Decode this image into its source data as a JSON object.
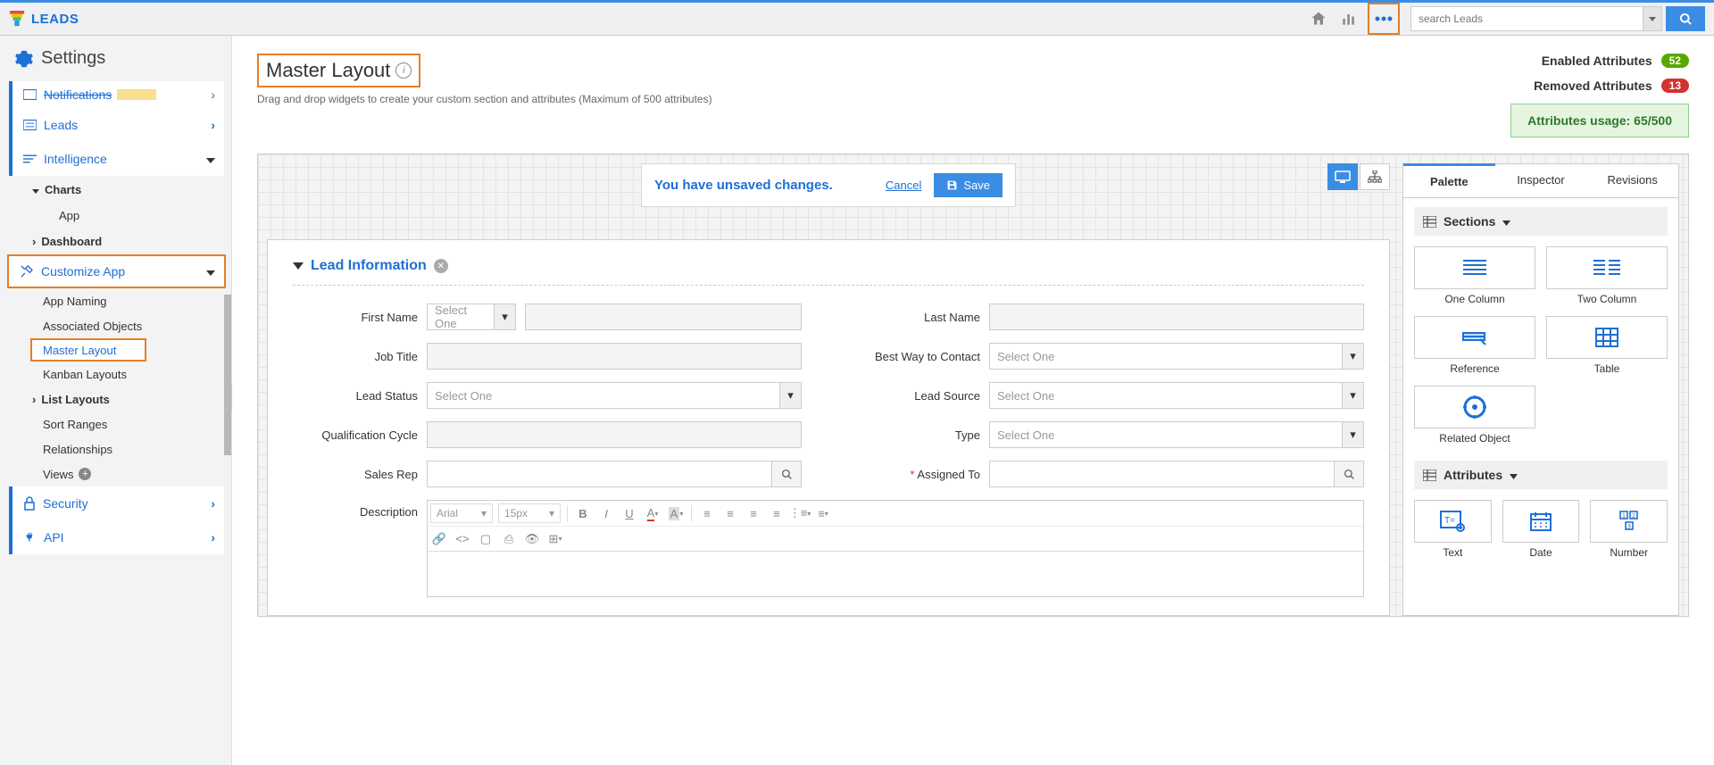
{
  "app": {
    "name": "LEADS"
  },
  "search": {
    "placeholder": "search Leads"
  },
  "settings": {
    "title": "Settings",
    "notifications": "Notifications",
    "leads": "Leads",
    "intelligence": "Intelligence",
    "charts": "Charts",
    "app_item": "App",
    "dashboard": "Dashboard",
    "customize": "Customize App",
    "app_naming": "App Naming",
    "associated": "Associated Objects",
    "master": "Master Layout",
    "kanban": "Kanban Layouts",
    "list_layouts": "List Layouts",
    "sort_ranges": "Sort Ranges",
    "relationships": "Relationships",
    "views": "Views",
    "security": "Security",
    "api": "API"
  },
  "page": {
    "title": "Master Layout",
    "subtitle": "Drag and drop widgets to create your custom section and attributes (Maximum of 500 attributes)",
    "enabled_label": "Enabled Attributes",
    "enabled_count": "52",
    "removed_label": "Removed Attributes",
    "removed_count": "13",
    "usage": "Attributes usage: 65/500"
  },
  "unsaved": {
    "text": "You have unsaved changes.",
    "cancel": "Cancel",
    "save": "Save"
  },
  "section": {
    "title": "Lead Information"
  },
  "fields": {
    "first_name": "First Name",
    "last_name": "Last Name",
    "job_title": "Job Title",
    "best_way": "Best Way to Contact",
    "lead_status": "Lead Status",
    "lead_source": "Lead Source",
    "qual_cycle": "Qualification Cycle",
    "type": "Type",
    "sales_rep": "Sales Rep",
    "assigned_to": "Assigned To",
    "description": "Description",
    "select_one": "Select One"
  },
  "rte": {
    "font": "Arial",
    "size": "15px"
  },
  "palette": {
    "tabs": {
      "palette": "Palette",
      "inspector": "Inspector",
      "revisions": "Revisions"
    },
    "sections_head": "Sections",
    "attributes_head": "Attributes",
    "items": {
      "one_col": "One Column",
      "two_col": "Two Column",
      "reference": "Reference",
      "table": "Table",
      "related": "Related Object",
      "text": "Text",
      "date": "Date",
      "number": "Number"
    }
  }
}
